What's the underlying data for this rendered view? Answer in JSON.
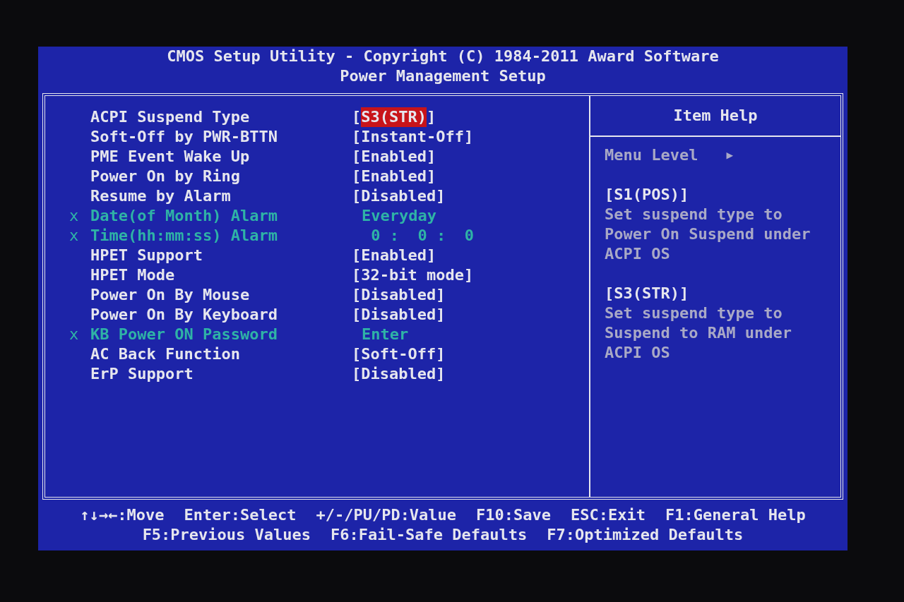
{
  "header": {
    "title": "CMOS Setup Utility - Copyright (C) 1984-2011 Award Software",
    "subtitle": "Power Management Setup"
  },
  "settings": [
    {
      "label": "ACPI Suspend Type",
      "bracket_open": "[",
      "value": "S3(STR)",
      "bracket_close": "]",
      "selected": true,
      "disabled": false
    },
    {
      "label": "Soft-Off by PWR-BTTN",
      "bracket_open": "[",
      "value": "Instant-Off",
      "bracket_close": "]",
      "selected": false,
      "disabled": false
    },
    {
      "label": "PME Event Wake Up",
      "bracket_open": "[",
      "value": "Enabled",
      "bracket_close": "]",
      "selected": false,
      "disabled": false
    },
    {
      "label": "Power On by Ring",
      "bracket_open": "[",
      "value": "Enabled",
      "bracket_close": "]",
      "selected": false,
      "disabled": false
    },
    {
      "label": "Resume by Alarm",
      "bracket_open": "[",
      "value": "Disabled",
      "bracket_close": "]",
      "selected": false,
      "disabled": false
    },
    {
      "marker": "x",
      "label": "Date(of Month) Alarm",
      "value": "Everyday",
      "selected": false,
      "disabled": true
    },
    {
      "marker": "x",
      "label": "Time(hh:mm:ss) Alarm",
      "value": " 0 :  0 :  0",
      "selected": false,
      "disabled": true
    },
    {
      "label": "HPET Support",
      "bracket_open": "[",
      "value": "Enabled",
      "bracket_close": "]",
      "selected": false,
      "disabled": false
    },
    {
      "label": "HPET Mode",
      "bracket_open": "[",
      "value": "32-bit mode",
      "bracket_close": "]",
      "selected": false,
      "disabled": false
    },
    {
      "label": "Power On By Mouse",
      "bracket_open": "[",
      "value": "Disabled",
      "bracket_close": "]",
      "selected": false,
      "disabled": false
    },
    {
      "label": "Power On By Keyboard",
      "bracket_open": "[",
      "value": "Disabled",
      "bracket_close": "]",
      "selected": false,
      "disabled": false
    },
    {
      "marker": "x",
      "label": "KB Power ON Password",
      "value": "Enter",
      "selected": false,
      "disabled": true
    },
    {
      "label": "AC Back Function",
      "bracket_open": "[",
      "value": "Soft-Off",
      "bracket_close": "]",
      "selected": false,
      "disabled": false
    },
    {
      "label": "ErP Support",
      "bracket_open": "[",
      "value": "Disabled",
      "bracket_close": "]",
      "selected": false,
      "disabled": false
    }
  ],
  "item_help": {
    "title": "Item Help",
    "menu_level": "Menu Level",
    "menu_level_arrow": "▶",
    "entries": [
      {
        "option": "[S1(POS)]",
        "text": "Set suspend type to Power On Suspend under ACPI OS"
      },
      {
        "option": "[S3(STR)]",
        "text": "Set suspend type to Suspend to RAM under ACPI OS"
      }
    ]
  },
  "footer": [
    [
      "↑↓→←:Move",
      "Enter:Select",
      "+/-/PU/PD:Value",
      "F10:Save",
      "ESC:Exit",
      "F1:General Help"
    ],
    [
      "F5:Previous Values",
      "F6:Fail-Safe Defaults",
      "F7:Optimized Defaults"
    ]
  ]
}
